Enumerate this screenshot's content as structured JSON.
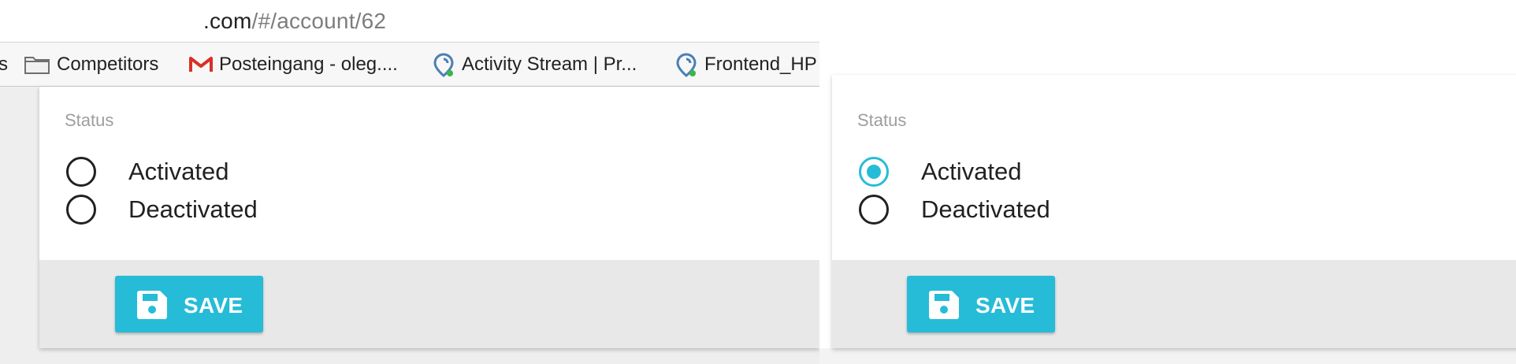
{
  "left": {
    "browser": {
      "url": {
        "domain": ".com",
        "path": "/#/account/62"
      },
      "bookmarks": [
        {
          "label": "s",
          "icon": "folder-icon"
        },
        {
          "label": "Competitors",
          "icon": "folder-icon"
        },
        {
          "label": "Posteingang - oleg....",
          "icon": "gmail-icon"
        },
        {
          "label": "Activity Stream | Pr...",
          "icon": "pin-icon"
        },
        {
          "label": "Frontend_HP",
          "icon": "pin-icon"
        }
      ]
    },
    "form": {
      "status_label": "Status",
      "options": [
        {
          "label": "Activated",
          "checked": false
        },
        {
          "label": "Deactivated",
          "checked": false
        }
      ],
      "save_label": "SAVE"
    }
  },
  "right": {
    "form": {
      "status_label": "Status",
      "options": [
        {
          "label": "Activated",
          "checked": true
        },
        {
          "label": "Deactivated",
          "checked": false
        }
      ],
      "save_label": "SAVE"
    }
  },
  "colors": {
    "accent": "#26bcd7",
    "footer": "#e8e8e8",
    "muted_text": "#9e9e9e",
    "text": "#212121"
  }
}
